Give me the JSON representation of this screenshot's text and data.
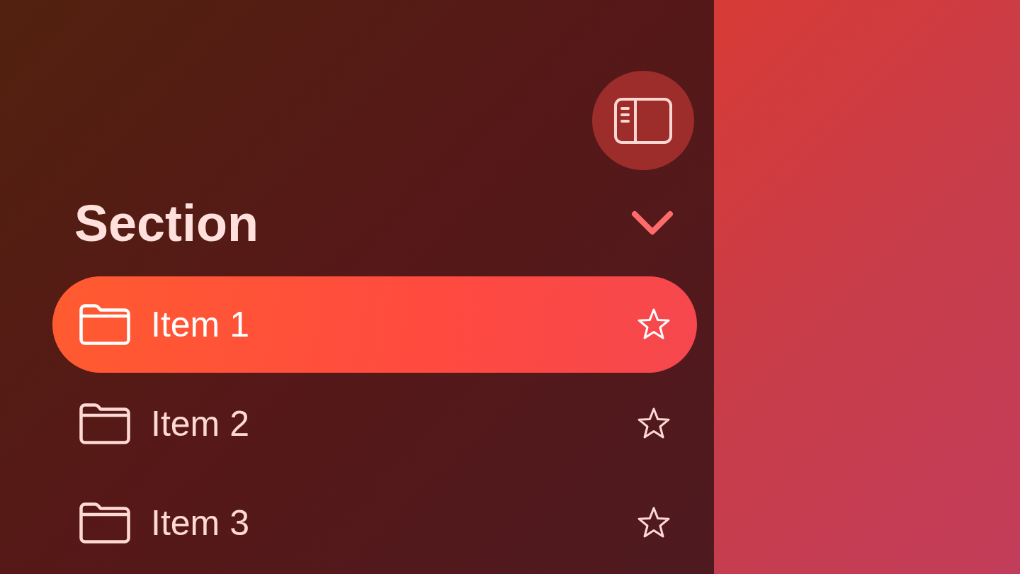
{
  "sidebar": {
    "section": {
      "title": "Section",
      "expanded": true,
      "items": [
        {
          "label": "Item 1",
          "selected": true,
          "favorite": false
        },
        {
          "label": "Item 2",
          "selected": false,
          "favorite": false
        },
        {
          "label": "Item 3",
          "selected": false,
          "favorite": false
        }
      ]
    }
  }
}
